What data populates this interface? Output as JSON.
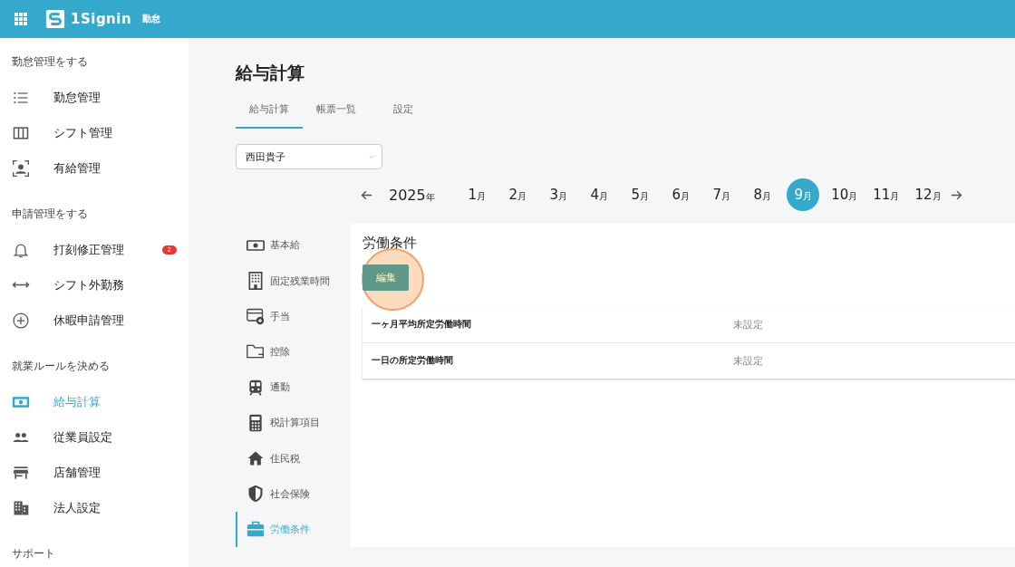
{
  "header": {
    "app_name": "1Signin",
    "app_badge": "勤怠"
  },
  "sidebar": {
    "sections": [
      {
        "title": "勤怠管理をする",
        "items": [
          {
            "label": "勤怠管理",
            "selected": false
          },
          {
            "label": "シフト管理",
            "selected": false
          },
          {
            "label": "有給管理",
            "selected": false
          }
        ]
      },
      {
        "title": "申請管理をする",
        "items": [
          {
            "label": "打刻修正管理",
            "selected": false,
            "badge": "2"
          },
          {
            "label": "シフト外勤務",
            "selected": false
          },
          {
            "label": "休暇申請管理",
            "selected": false
          }
        ]
      },
      {
        "title": "就業ルールを決める",
        "items": [
          {
            "label": "給与計算",
            "selected": true
          },
          {
            "label": "従業員設定",
            "selected": false
          },
          {
            "label": "店舗管理",
            "selected": false
          },
          {
            "label": "法人設定",
            "selected": false
          }
        ]
      },
      {
        "title": "サポート"
      }
    ]
  },
  "page": {
    "title": "給与計算",
    "tabs": [
      {
        "label": "給与計算",
        "selected": true
      },
      {
        "label": "帳票一覧",
        "selected": false
      },
      {
        "label": "設定",
        "selected": false
      }
    ],
    "employee_select": {
      "value": "西田貴子"
    },
    "year": {
      "number": "2025",
      "unit": "年"
    },
    "months": [
      {
        "number": "1",
        "unit": "月",
        "selected": false
      },
      {
        "number": "2",
        "unit": "月",
        "selected": false
      },
      {
        "number": "3",
        "unit": "月",
        "selected": false
      },
      {
        "number": "4",
        "unit": "月",
        "selected": false
      },
      {
        "number": "5",
        "unit": "月",
        "selected": false
      },
      {
        "number": "6",
        "unit": "月",
        "selected": false
      },
      {
        "number": "7",
        "unit": "月",
        "selected": false
      },
      {
        "number": "8",
        "unit": "月",
        "selected": false
      },
      {
        "number": "9",
        "unit": "月",
        "selected": true
      },
      {
        "number": "10",
        "unit": "月",
        "selected": false
      },
      {
        "number": "11",
        "unit": "月",
        "selected": false
      },
      {
        "number": "12",
        "unit": "月",
        "selected": false
      }
    ],
    "categories": [
      {
        "label": "基本給",
        "selected": false
      },
      {
        "label": "固定残業時間",
        "selected": false
      },
      {
        "label": "手当",
        "selected": false
      },
      {
        "label": "控除",
        "selected": false
      },
      {
        "label": "通勤",
        "selected": false
      },
      {
        "label": "税計算項目",
        "selected": false
      },
      {
        "label": "住民税",
        "selected": false
      },
      {
        "label": "社会保険",
        "selected": false
      },
      {
        "label": "労働条件",
        "selected": true
      }
    ],
    "panel": {
      "title": "労働条件",
      "edit_button": "編集",
      "highlighted": true,
      "rows": [
        {
          "label": "一ヶ月平均所定労働時間",
          "value": "未設定"
        },
        {
          "label": "一日の所定労働時間",
          "value": "未設定"
        }
      ]
    }
  }
}
